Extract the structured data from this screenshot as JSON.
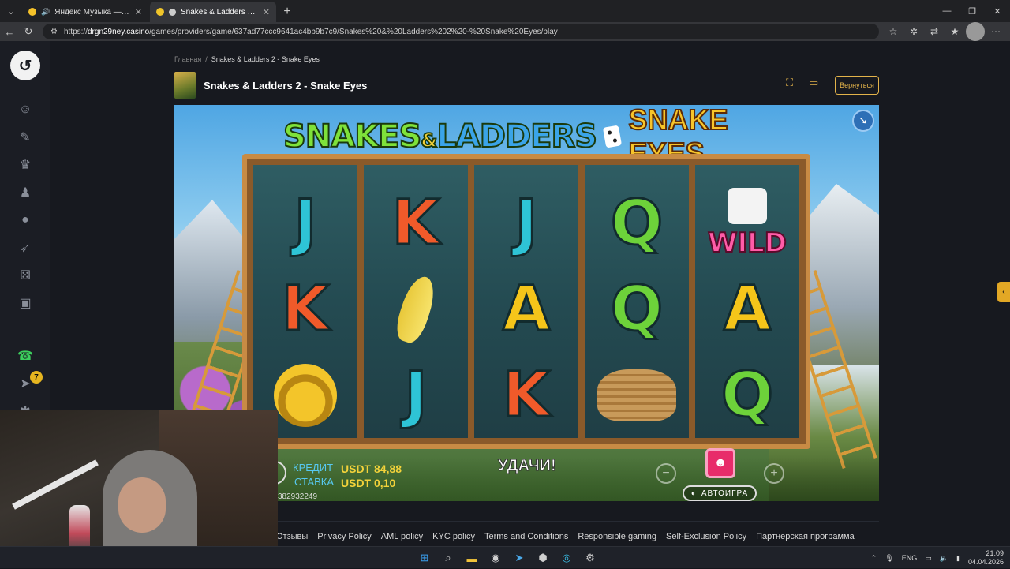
{
  "browser": {
    "tabs": [
      {
        "title": "Яндекс Музыка — собирае",
        "active": false
      },
      {
        "title": "Snakes & Ladders 2 - Snake E",
        "active": true
      }
    ],
    "url_prefix": "https://",
    "url_host": "drgn29ney.casino",
    "url_path": "/games/providers/game/637ad77ccc9641ac4bb9b7c9/Snakes%20&%20Ladders%202%20-%20Snake%20Eyes/play"
  },
  "site": {
    "breadcrumb": {
      "home": "Главная",
      "sep": "/",
      "current": "Snakes & Ladders 2 - Snake Eyes"
    },
    "game_title": "Snakes & Ladders 2 - Snake Eyes",
    "back_label": "Вернуться",
    "footer_links": [
      "Отзывы",
      "Privacy Policy",
      "AML policy",
      "KYC policy",
      "Terms and Conditions",
      "Responsible gaming",
      "Self-Exclusion Policy",
      "Партнерская программа"
    ],
    "badge_count": "7"
  },
  "game": {
    "logo_left_a": "SNAKES",
    "logo_amp": "&",
    "logo_left_b": "LADDERS",
    "logo_right": "SNAKE EYES",
    "reels": [
      [
        "J",
        "K",
        "snake"
      ],
      [
        "K",
        "banana",
        "J"
      ],
      [
        "J",
        "A",
        "K"
      ],
      [
        "Q",
        "Q",
        "basket"
      ],
      [
        "WILD",
        "A",
        "Q"
      ]
    ],
    "credit_label": "КРЕДИТ",
    "credit_value": "USDT 84,88",
    "stake_label": "СТАВКА",
    "stake_value": "USDT 0,10",
    "round_id": "382932249",
    "message": "УДАЧИ!",
    "autoplay_label": "АВТОИГРА"
  },
  "taskbar": {
    "lang": "ENG",
    "time": "21:09",
    "date": "04.04.2026"
  }
}
